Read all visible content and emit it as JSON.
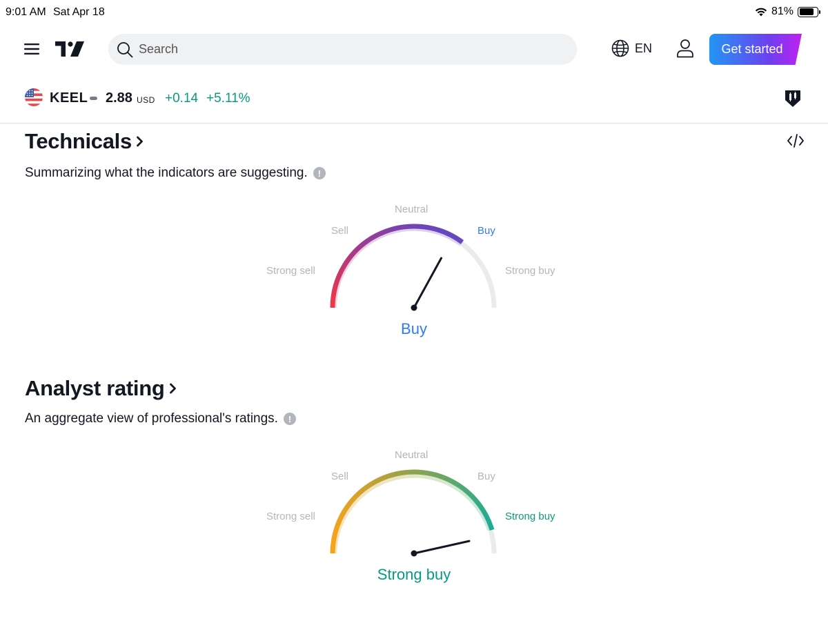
{
  "status": {
    "time": "9:01 AM",
    "date": "Sat Apr 18",
    "battery": "81%",
    "battery_level": 0.81
  },
  "nav": {
    "search_placeholder": "Search",
    "language": "EN",
    "cta": "Get started"
  },
  "ticker": {
    "symbol": "KEEL",
    "price": "2.88",
    "currency": "USD",
    "change": "+0.14",
    "change_pct": "+5.11%",
    "change_color": "#089981"
  },
  "technicals": {
    "title": "Technicals",
    "subtitle": "Summarizing what the indicators are suggesting.",
    "labels": {
      "strong_sell": "Strong sell",
      "sell": "Sell",
      "neutral": "Neutral",
      "buy": "Buy",
      "strong_buy": "Strong buy"
    },
    "result": "Buy",
    "result_color": "#3179f5",
    "needle_fraction": 0.66
  },
  "analyst": {
    "title": "Analyst rating",
    "subtitle": "An aggregate view of professional's ratings.",
    "labels": {
      "strong_sell": "Strong sell",
      "sell": "Sell",
      "neutral": "Neutral",
      "buy": "Buy",
      "strong_buy": "Strong buy"
    },
    "result": "Strong buy",
    "result_color": "#089981",
    "needle_fraction": 0.93
  },
  "icons": {
    "menu": "menu-icon",
    "logo": "tradingview-logo",
    "search": "search-icon",
    "globe": "globe-icon",
    "user": "user-icon",
    "flag": "us-flag-icon",
    "pine": "pine-editor-icon",
    "embed": "embed-code-icon",
    "info": "info-icon",
    "chevron": "chevron-right-icon"
  }
}
